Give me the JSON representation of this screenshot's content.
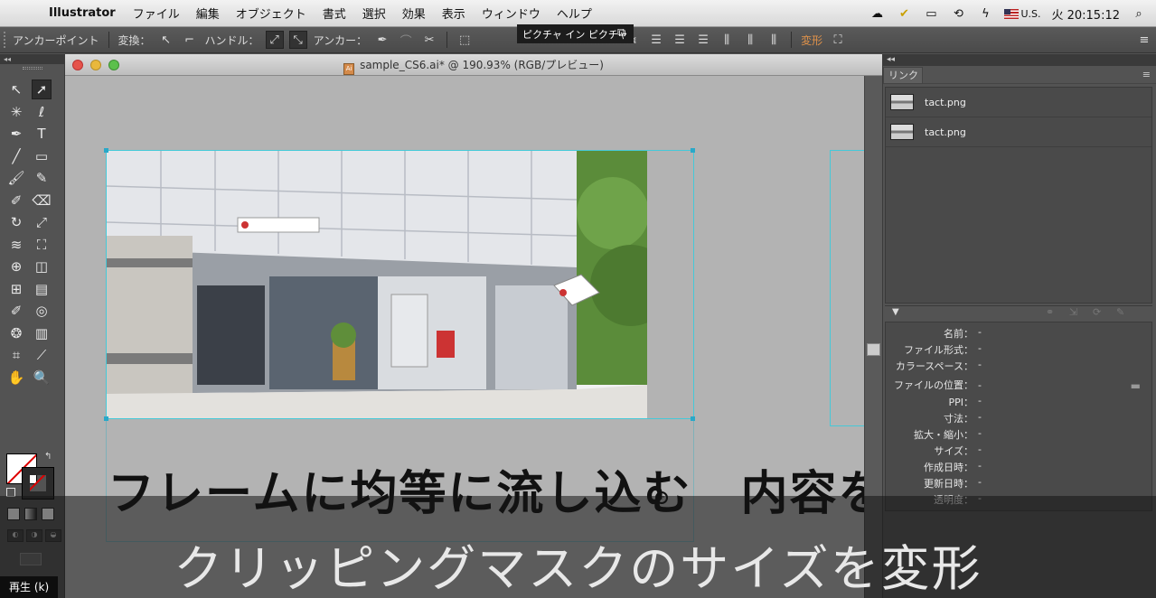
{
  "menubar": {
    "apple": "",
    "app_name": "Illustrator",
    "items": [
      "ファイル",
      "編集",
      "オブジェクト",
      "書式",
      "選択",
      "効果",
      "表示",
      "ウィンドウ",
      "ヘルプ"
    ],
    "input_source": "U.S.",
    "clock": "火 20:15:12"
  },
  "controlbar": {
    "mode_label": "アンカーポイント",
    "convert_label": "変換：",
    "handle_label": "ハンドル：",
    "anchor_label": "アンカー：",
    "tooltip": "ピクチャ イン ピクチャ",
    "transform_label": "変形"
  },
  "tools": {
    "header": "◂◂",
    "icons": [
      "direct-selection",
      "selection",
      "magic-wand",
      "lasso",
      "pen",
      "type",
      "line",
      "rectangle",
      "paintbrush",
      "pencil",
      "blob-brush",
      "eraser",
      "rotate",
      "scale",
      "warp",
      "free-transform",
      "shape-builder",
      "perspective",
      "mesh",
      "gradient",
      "eyedropper",
      "blend",
      "symbol-sprayer",
      "column-graph",
      "artboard",
      "slice",
      "hand",
      "zoom"
    ]
  },
  "document": {
    "title": "sample_CS6.ai* @ 190.93% (RGB/プレビュー)",
    "canvas_text": "フレームに均等に流し込む　内容を"
  },
  "links_panel": {
    "header": "◂◂",
    "tab_label": "リンク",
    "links": [
      {
        "name": "tact.png"
      },
      {
        "name": "tact.png"
      }
    ],
    "info": [
      {
        "key": "名前：",
        "value": "-"
      },
      {
        "key": "ファイル形式：",
        "value": "-"
      },
      {
        "key": "カラースペース：",
        "value": "-"
      },
      {
        "key": "ファイルの位置：",
        "value": "-"
      },
      {
        "key": "PPI：",
        "value": "-"
      },
      {
        "key": "寸法：",
        "value": "-"
      },
      {
        "key": "拡大・縮小：",
        "value": "-"
      },
      {
        "key": "サイズ：",
        "value": "-"
      },
      {
        "key": "作成日時：",
        "value": "-"
      },
      {
        "key": "更新日時：",
        "value": "-"
      },
      {
        "key": "透明度：",
        "value": "-"
      }
    ]
  },
  "overlay": {
    "subtitle": "クリッピングマスクのサイズを変形",
    "play_label": "再生 (k)"
  }
}
